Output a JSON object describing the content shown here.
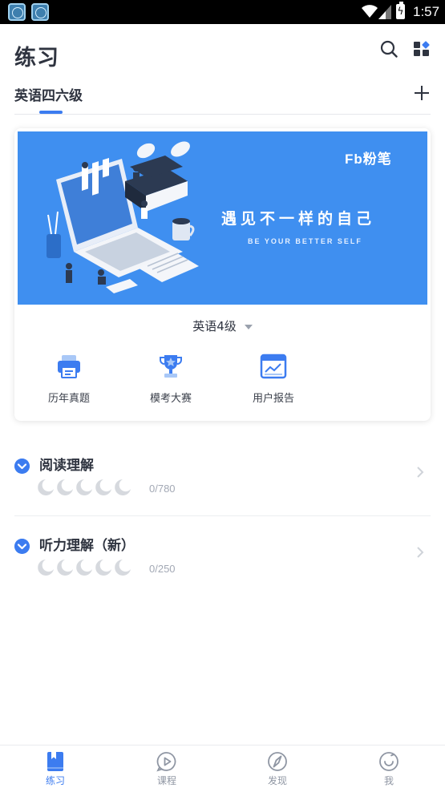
{
  "status_bar": {
    "time": "1:57",
    "notifications": [
      "notification-app-icon",
      "notification-app-icon"
    ]
  },
  "header": {
    "title": "练习",
    "icons": [
      "search-icon",
      "grid-icon"
    ]
  },
  "tabs": {
    "active_label": "英语四六级",
    "add_icon": "plus-icon"
  },
  "banner": {
    "logo": "Fb粉笔",
    "headline": "遇见不一样的自己",
    "subline": "BE YOUR BETTER SELF",
    "background": "#3f8ff0"
  },
  "level_select": {
    "value": "英语4级"
  },
  "shortcuts": [
    {
      "label": "历年真题",
      "icon": "printer-icon"
    },
    {
      "label": "模考大赛",
      "icon": "trophy-icon"
    },
    {
      "label": "用户报告",
      "icon": "report-chart-icon"
    }
  ],
  "subjects": [
    {
      "title": "阅读理解",
      "progress": "0/780",
      "level": 0,
      "level_max": 5
    },
    {
      "title": "听力理解（新）",
      "progress": "0/250",
      "level": 0,
      "level_max": 5
    }
  ],
  "bottom_nav": [
    {
      "label": "练习",
      "icon": "book-icon",
      "active": true
    },
    {
      "label": "课程",
      "icon": "play-bubble-icon",
      "active": false
    },
    {
      "label": "发现",
      "icon": "compass-icon",
      "active": false
    },
    {
      "label": "我",
      "icon": "smile-icon",
      "active": false
    }
  ],
  "colors": {
    "accent": "#3c7cf0",
    "text": "#2f3440",
    "muted": "#a3a9b5"
  }
}
